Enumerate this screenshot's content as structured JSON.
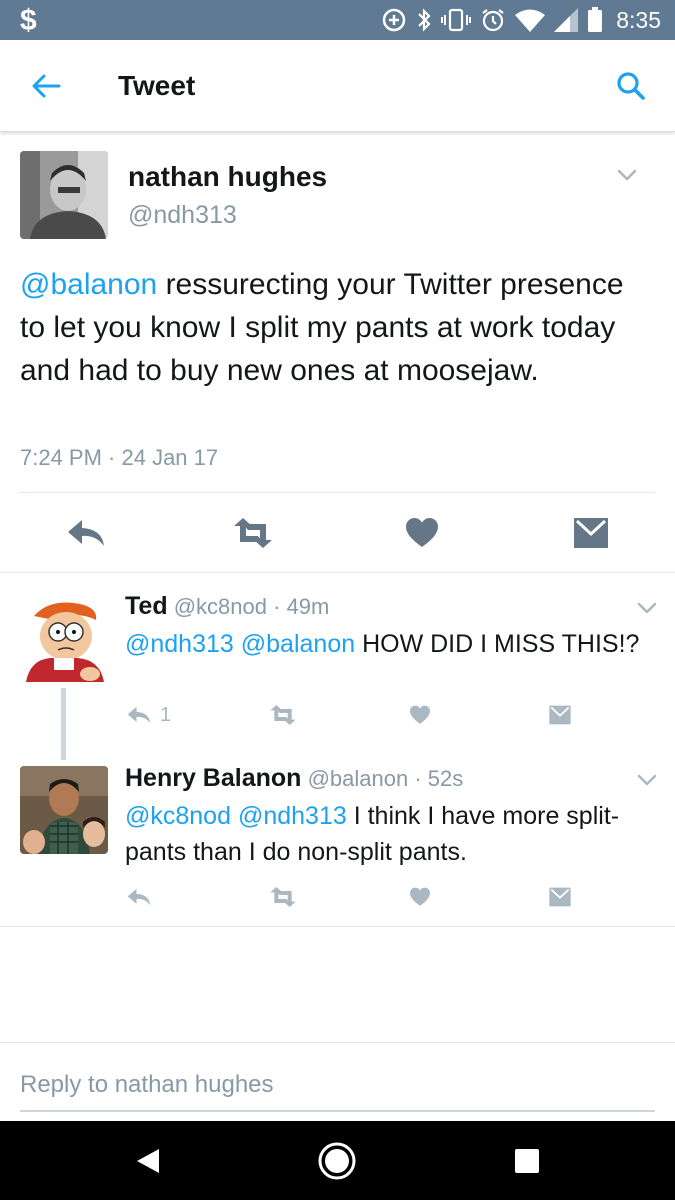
{
  "status_bar": {
    "left_glyph": "$",
    "time": "8:35",
    "icons": [
      "add-circle-icon",
      "bluetooth-icon",
      "vibrate-icon",
      "alarm-icon",
      "wifi-icon",
      "signal-icon",
      "battery-icon"
    ]
  },
  "app_bar": {
    "title": "Tweet",
    "back_icon": "arrow-left-icon",
    "search_icon": "search-icon"
  },
  "main_tweet": {
    "author_name": "nathan hughes",
    "author_handle": "@ndh313",
    "mention": "@balanon",
    "text": " ressurecting your Twitter presence to let you know I split my pants at work today and had to buy new ones at moosejaw.",
    "timestamp": "7:24 PM · 24 Jan 17",
    "actions": [
      "reply-icon",
      "retweet-icon",
      "like-icon",
      "direct-message-icon"
    ]
  },
  "replies": [
    {
      "name": "Ted",
      "handle": "@kc8nod",
      "time": "· 49m",
      "mentions": [
        "@ndh313",
        "@balanon"
      ],
      "text": " HOW DID I MISS THIS!?",
      "reply_count": "1"
    },
    {
      "name": "Henry Balanon",
      "handle": "@balanon",
      "time": "· 52s",
      "mentions": [
        "@kc8nod",
        "@ndh313"
      ],
      "text": " I think I have more split-pants than I do non-split pants.",
      "reply_count": ""
    }
  ],
  "composer": {
    "placeholder": "Reply to nathan hughes"
  },
  "colors": {
    "status_bar": "#5f7a92",
    "accent": "#1da1f2",
    "action_icon": "#657786",
    "muted_icon": "#aab8c2",
    "secondary_text": "#8899a6"
  }
}
